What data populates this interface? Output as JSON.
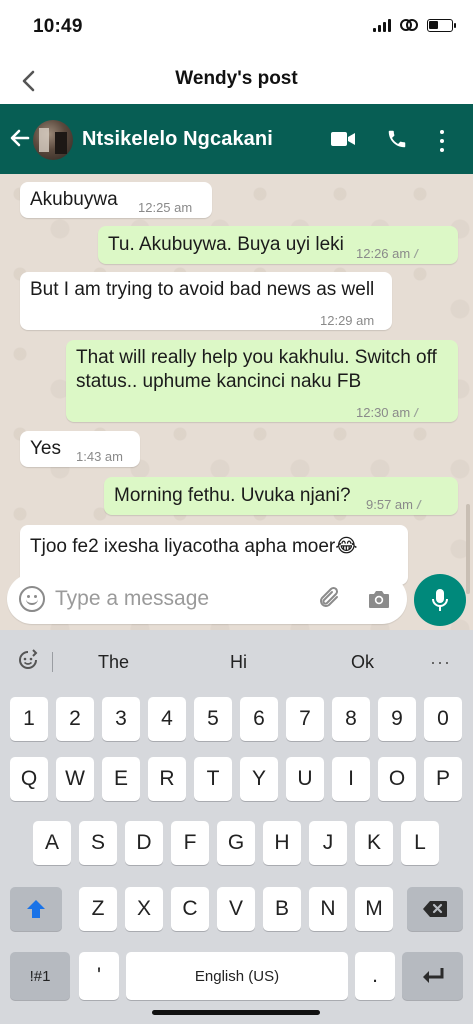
{
  "status_bar": {
    "time": "10:49",
    "battery_fraction": 0.45
  },
  "post_header": {
    "title": "Wendy's post"
  },
  "chat_header": {
    "contact_name": "Ntsikelelo Ngcakani"
  },
  "messages": [
    {
      "direction": "in",
      "text": "Akubuywa",
      "time": "12:25 am"
    },
    {
      "direction": "out",
      "text": "Tu. Akubuywa. Buya uyi leki",
      "time": "12:26 am"
    },
    {
      "direction": "in",
      "text": "But I am trying to avoid bad news as well",
      "time": "12:29 am"
    },
    {
      "direction": "out",
      "text": "That will really help you kakhulu.  Switch off status.. uphume kancinci naku FB",
      "time": "12:30 am"
    },
    {
      "direction": "in",
      "text": "Yes",
      "time": "1:43 am"
    },
    {
      "direction": "out",
      "text": "Morning fethu. Uvuka njani?",
      "time": "9:57 am"
    },
    {
      "direction": "in",
      "text": "Tjoo fe2 ixesha liyacotha apha moer😂",
      "time": ""
    }
  ],
  "composer": {
    "placeholder": "Type a message"
  },
  "keyboard": {
    "suggestions": [
      "The",
      "Hi",
      "Ok"
    ],
    "more": "···",
    "row_numbers": [
      "1",
      "2",
      "3",
      "4",
      "5",
      "6",
      "7",
      "8",
      "9",
      "0"
    ],
    "row_q": [
      "Q",
      "W",
      "E",
      "R",
      "T",
      "Y",
      "U",
      "I",
      "O",
      "P"
    ],
    "row_a": [
      "A",
      "S",
      "D",
      "F",
      "G",
      "H",
      "J",
      "K",
      "L"
    ],
    "row_z": [
      "Z",
      "X",
      "C",
      "V",
      "B",
      "N",
      "M"
    ],
    "symbols_key": "!#1",
    "apostrophe_key": "'",
    "space_key": "English (US)",
    "period_key": "."
  },
  "colors": {
    "wa_header": "#075e54",
    "outgoing_bubble": "#dcf8c6",
    "mic_button": "#00897b",
    "shift_arrow": "#1a73e8"
  },
  "icons": [
    "back-chevron-icon",
    "back-arrow-icon",
    "video-call-icon",
    "phone-icon",
    "menu-dots-icon",
    "emoji-icon",
    "attach-clip-icon",
    "camera-icon",
    "mic-icon",
    "chevrons-down-icon",
    "shift-icon",
    "backspace-icon",
    "enter-icon",
    "clipboard-tool-icon"
  ]
}
